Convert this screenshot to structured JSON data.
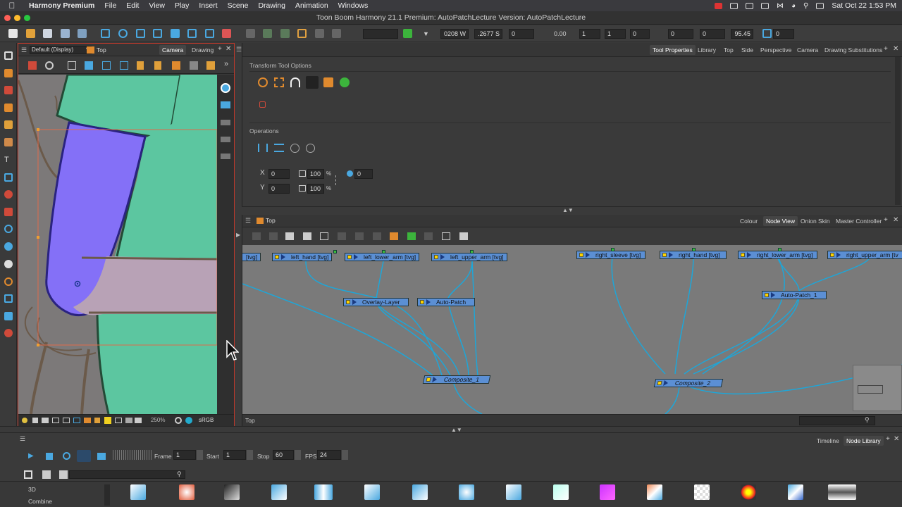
{
  "menubar": {
    "app_name": "Harmony Premium",
    "items": [
      "File",
      "Edit",
      "View",
      "Play",
      "Insert",
      "Scene",
      "Drawing",
      "Animation",
      "Windows"
    ],
    "clock": "Sat Oct 22  1:53 PM"
  },
  "window": {
    "title": "Toon Boom Harmony 21.1 Premium: AutoPatchLecture Version: AutoPatchLecture"
  },
  "toptoolbar": {
    "field_w": "0208 W",
    "field_s": ".2677 S",
    "field_zero1": "0",
    "field_angle": "0.00",
    "field_one_a": "1",
    "field_one_b": "1",
    "field_zero2": "0",
    "field_zero3": "0",
    "field_zero4": "0",
    "field_pct": "95.45",
    "field_zero5": "0"
  },
  "camera": {
    "display_select": "Default (Display)",
    "breadcrumb": "Top",
    "tabs": [
      "Camera",
      "Drawing"
    ],
    "zoom": "250%",
    "colorspace": "sRGB"
  },
  "toolprops": {
    "tabs": [
      "Tool Properties",
      "Library",
      "Top",
      "Side",
      "Perspective",
      "Camera",
      "Drawing Substitutions"
    ],
    "section_transform": "Transform Tool Options",
    "section_operations": "Operations",
    "x_value": "0",
    "y_value": "0",
    "w_value": "100",
    "h_value": "100",
    "pct_symbol": "%",
    "angle_value": "0",
    "x_label": "X",
    "y_label": "Y"
  },
  "nodeview": {
    "breadcrumb": "Top",
    "tabs": [
      "Colour",
      "Node View",
      "Onion Skin",
      "Master Controller"
    ],
    "bottom_label": "Top",
    "nodes": {
      "tvg": "[tvg]",
      "left_hand": "left_hand  [tvg]",
      "left_lower_arm": "left_lower_arm  [tvg]",
      "left_upper_arm": "left_upper_arm  [tvg]",
      "overlay_layer": "Overlay-Layer",
      "auto_patch": "Auto-Patch",
      "composite_1": "Composite_1",
      "right_sleeve": "right_sleeve  [tvg]",
      "right_hand": "right_hand  [tvg]",
      "right_lower_arm": "right_lower_arm  [tvg]",
      "right_upper_arm": "right_upper_arm  [tv",
      "auto_patch_1": "Auto-Patch_1",
      "composite_2": "Composite_2"
    }
  },
  "timeline": {
    "tabs": [
      "Timeline",
      "Node Library"
    ],
    "frame_label": "Frame",
    "frame_value": "1",
    "start_label": "Start",
    "start_value": "1",
    "stop_label": "Stop",
    "stop_value": "60",
    "fps_label": "FPS",
    "fps_value": "24"
  },
  "library": {
    "categories": [
      "3D",
      "Combine"
    ]
  },
  "colors": {
    "node_blue": "#5b8fd4",
    "wire": "#1ea6d8",
    "port_yellow": "#ffd400",
    "camera_border": "#c0392b",
    "arm_purple": "#8470f7",
    "sleeve_green": "#5cc6a0",
    "forearm_pink": "#b8a2b6"
  }
}
